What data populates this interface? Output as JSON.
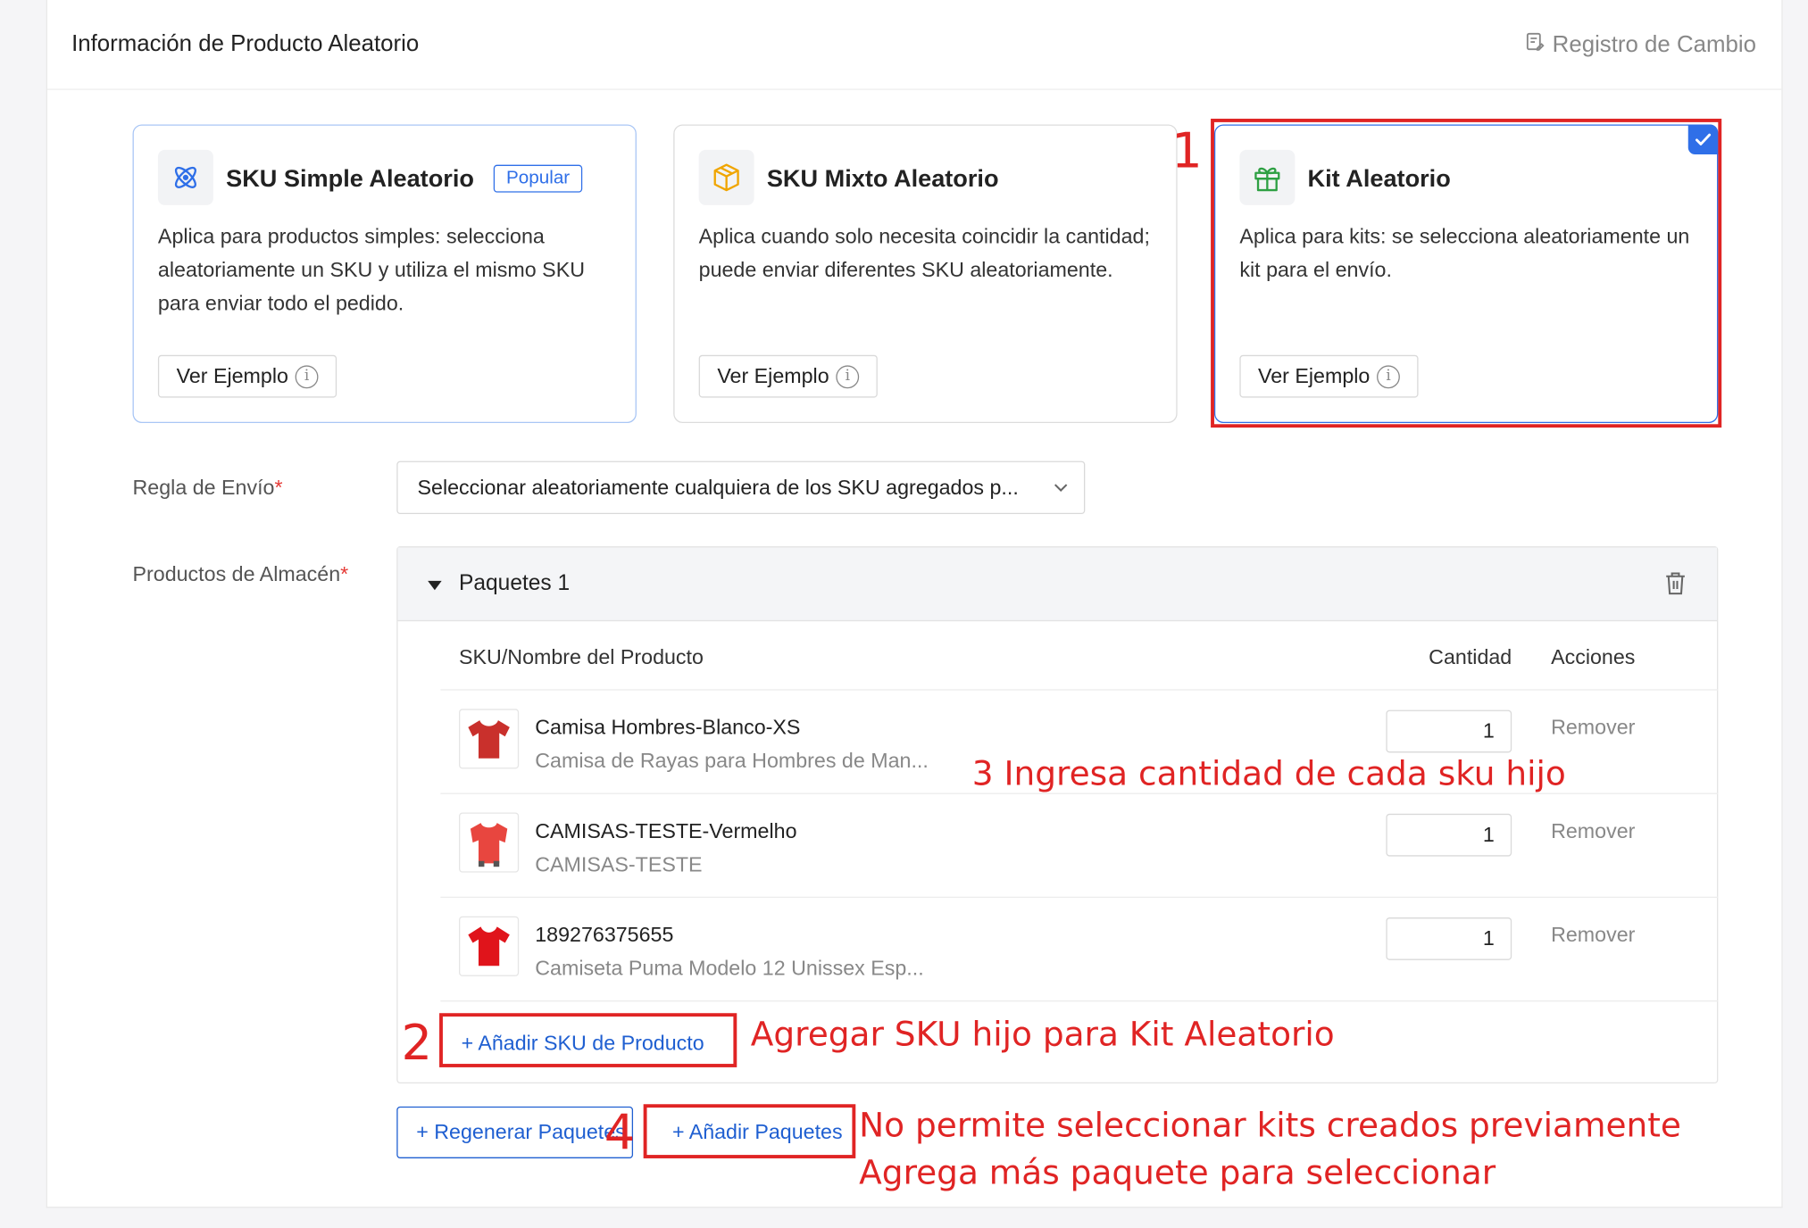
{
  "header": {
    "title": "Información de Producto Aleatorio",
    "changelog_label": "Registro de Cambio"
  },
  "cards": {
    "simple": {
      "title": "SKU Simple Aleatorio",
      "badge": "Popular",
      "description": "Aplica para productos simples: selecciona aleatoriamente un SKU y utiliza el mismo SKU para enviar todo el pedido.",
      "example_label": "Ver Ejemplo",
      "icon": "atom-icon"
    },
    "mixed": {
      "title": "SKU Mixto Aleatorio",
      "description": "Aplica cuando solo necesita coincidir la cantidad; puede enviar diferentes SKU aleatoriamente.",
      "example_label": "Ver Ejemplo",
      "icon": "box-icon"
    },
    "kit": {
      "title": "Kit Aleatorio",
      "description": "Aplica para kits: se selecciona aleatoriamente un kit para el envío.",
      "example_label": "Ver Ejemplo",
      "icon": "gift-icon",
      "selected": true
    }
  },
  "form": {
    "shipping_rule_label": "Regla de Envío",
    "shipping_rule_value": "Seleccionar aleatoriamente cualquiera de los SKU agregados p...",
    "warehouse_products_label": "Productos de Almacén",
    "required_mark": "*"
  },
  "package": {
    "title": "Paquetes 1",
    "columns": {
      "product": "SKU/Nombre del Producto",
      "quantity": "Cantidad",
      "actions": "Acciones"
    },
    "items": [
      {
        "name": "Camisa Hombres-Blanco-XS",
        "subtitle": "Camisa de Rayas para Hombres de Man...",
        "quantity": "1",
        "remove_label": "Remover",
        "color": "#c9302c"
      },
      {
        "name": "CAMISAS-TESTE-Vermelho",
        "subtitle": "CAMISAS-TESTE",
        "quantity": "1",
        "remove_label": "Remover",
        "color": "#e8463f"
      },
      {
        "name": "189276375655",
        "subtitle": "Camiseta Puma Modelo 12 Unissex Esp...",
        "quantity": "1",
        "remove_label": "Remover",
        "color": "#e0141b"
      }
    ],
    "add_sku_label": "+ Añadir SKU de Producto"
  },
  "actions": {
    "regenerate_label": "+ Regenerar Paquetes",
    "add_packages_label": "+ Añadir Paquetes"
  },
  "annotations": {
    "n1": "1",
    "n2": "2",
    "n3_text": "3 Ingresa cantidad de cada sku hijo",
    "n4": "4",
    "add_sku_note": "Agregar SKU hijo para Kit Aleatorio",
    "no_select_note": "No permite seleccionar kits creados previamente",
    "add_more_note": "Agrega más paquete para seleccionar"
  },
  "colors": {
    "primary": "#2f6fe8",
    "link": "#1f5fd1",
    "annotation": "#e02424",
    "required": "#e53935"
  }
}
